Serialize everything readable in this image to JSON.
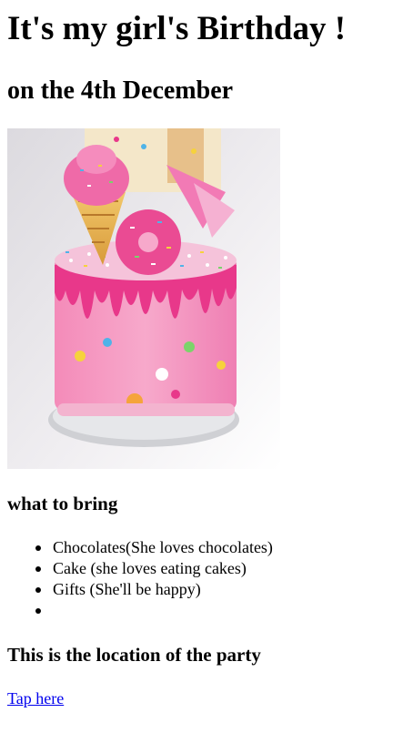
{
  "header": {
    "title": "It's my girl's Birthday !",
    "subtitle": "on the 4th December"
  },
  "image": {
    "subject": "pink drip birthday cake with sprinkles, donut and ice cream cone topper"
  },
  "bring": {
    "heading": "what to bring",
    "items": [
      {
        "label": "Chocolates(She loves chocolates)"
      },
      {
        "label": "Cake (she loves eating cakes)"
      },
      {
        "label": "Gifts (She'll be happy)"
      },
      {
        "label": ""
      }
    ]
  },
  "location": {
    "heading": "This is the location of the party",
    "link_label": "Tap here"
  },
  "colors": {
    "link": "#0000ee",
    "cake_pink": "#f06aa6",
    "drip_pink": "#e8388a"
  }
}
